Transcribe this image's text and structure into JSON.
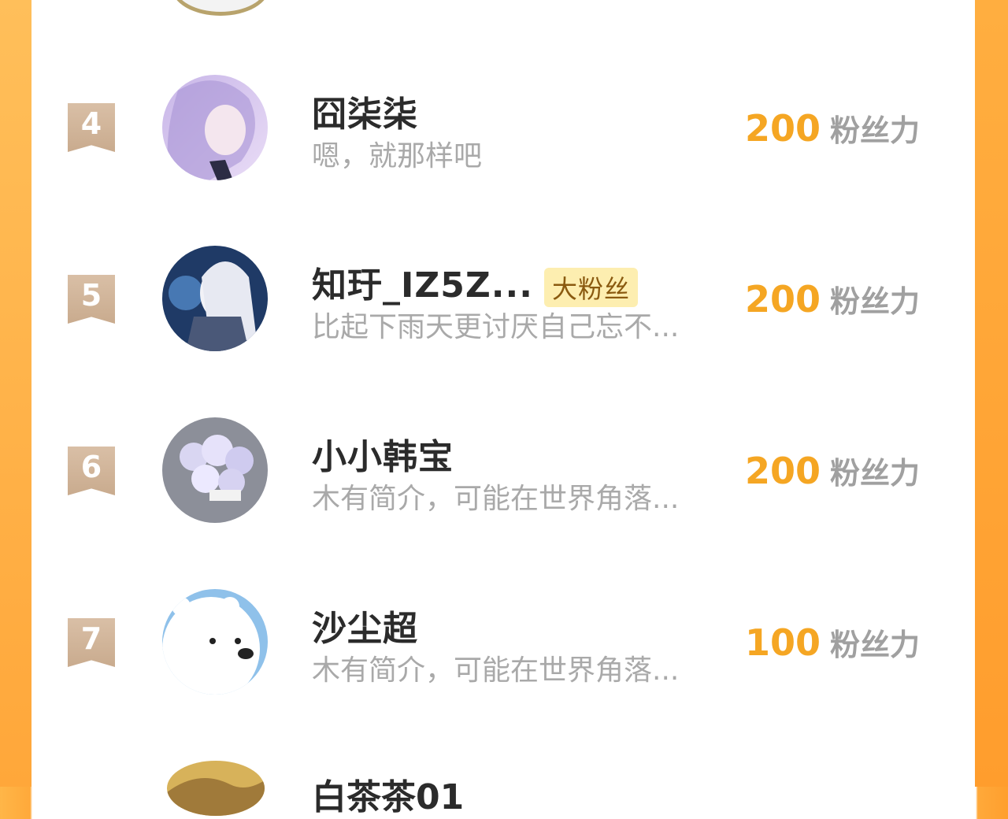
{
  "unit_label": "粉丝力",
  "colors": {
    "accent": "#f5a623",
    "frame": "#ffa93a",
    "rank_flag": "#cfb196",
    "badge_bg": "#fdeeb0"
  },
  "rows": [
    {
      "rank": "4",
      "name": "囧柒柒",
      "badge": "",
      "bio": "嗯，就那样吧",
      "score": "200"
    },
    {
      "rank": "5",
      "name": "知玗_IZ5Z...",
      "badge": "大粉丝",
      "bio": "比起下雨天更讨厌自己忘不...",
      "score": "200"
    },
    {
      "rank": "6",
      "name": "小小韩宝",
      "badge": "",
      "bio": "木有简介，可能在世界角落...",
      "score": "200"
    },
    {
      "rank": "7",
      "name": "沙尘超",
      "badge": "",
      "bio": "木有简介，可能在世界角落...",
      "score": "100"
    }
  ],
  "partial_next_row": {
    "name": "白茶茶01"
  }
}
